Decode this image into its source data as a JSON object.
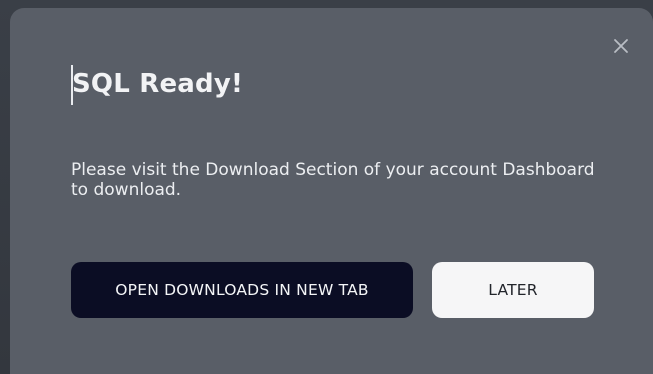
{
  "dialog": {
    "title": "SQL Ready!",
    "message": "Please visit the Download Section of your account Dashboard to download.",
    "primary_button_label": "OPEN DOWNLOADS IN NEW TAB",
    "secondary_button_label": "LATER",
    "close_icon": "close-icon"
  },
  "colors": {
    "dialog_background": "#595e67",
    "primary_button": "#0b0d24",
    "secondary_button": "#f6f6f7"
  }
}
